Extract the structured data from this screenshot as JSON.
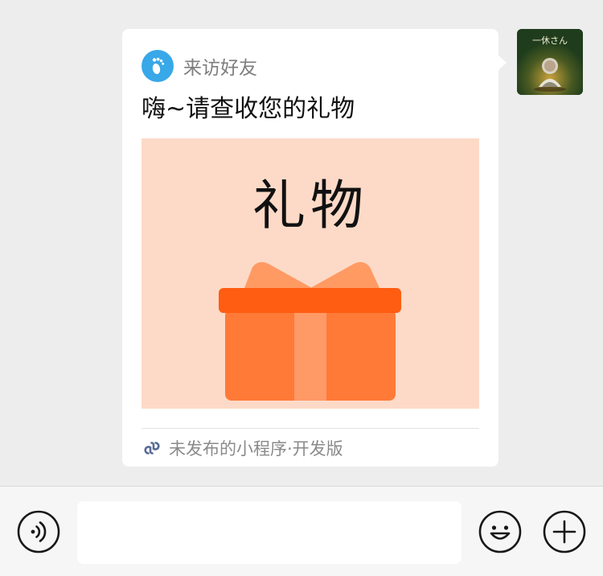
{
  "card": {
    "app_name": "来访好友",
    "title": "嗨~请查收您的礼物",
    "image_text": "礼物",
    "footer": "未发布的小程序·开发版"
  },
  "avatar": {
    "caption": "一休さん"
  },
  "input": {
    "value": "",
    "placeholder": ""
  },
  "icons": {
    "app": "footprint-icon",
    "footer": "mini-program-link-icon",
    "voice": "voice-icon",
    "emoji": "emoji-icon",
    "more": "plus-icon"
  },
  "colors": {
    "chat_bg": "#ededed",
    "app_icon": "#38a8e8",
    "gift_bg": "#fddac7",
    "gift_box": "#ff7a37",
    "gift_ribbon": "#ff5d12",
    "mini_program": "#576b95"
  }
}
